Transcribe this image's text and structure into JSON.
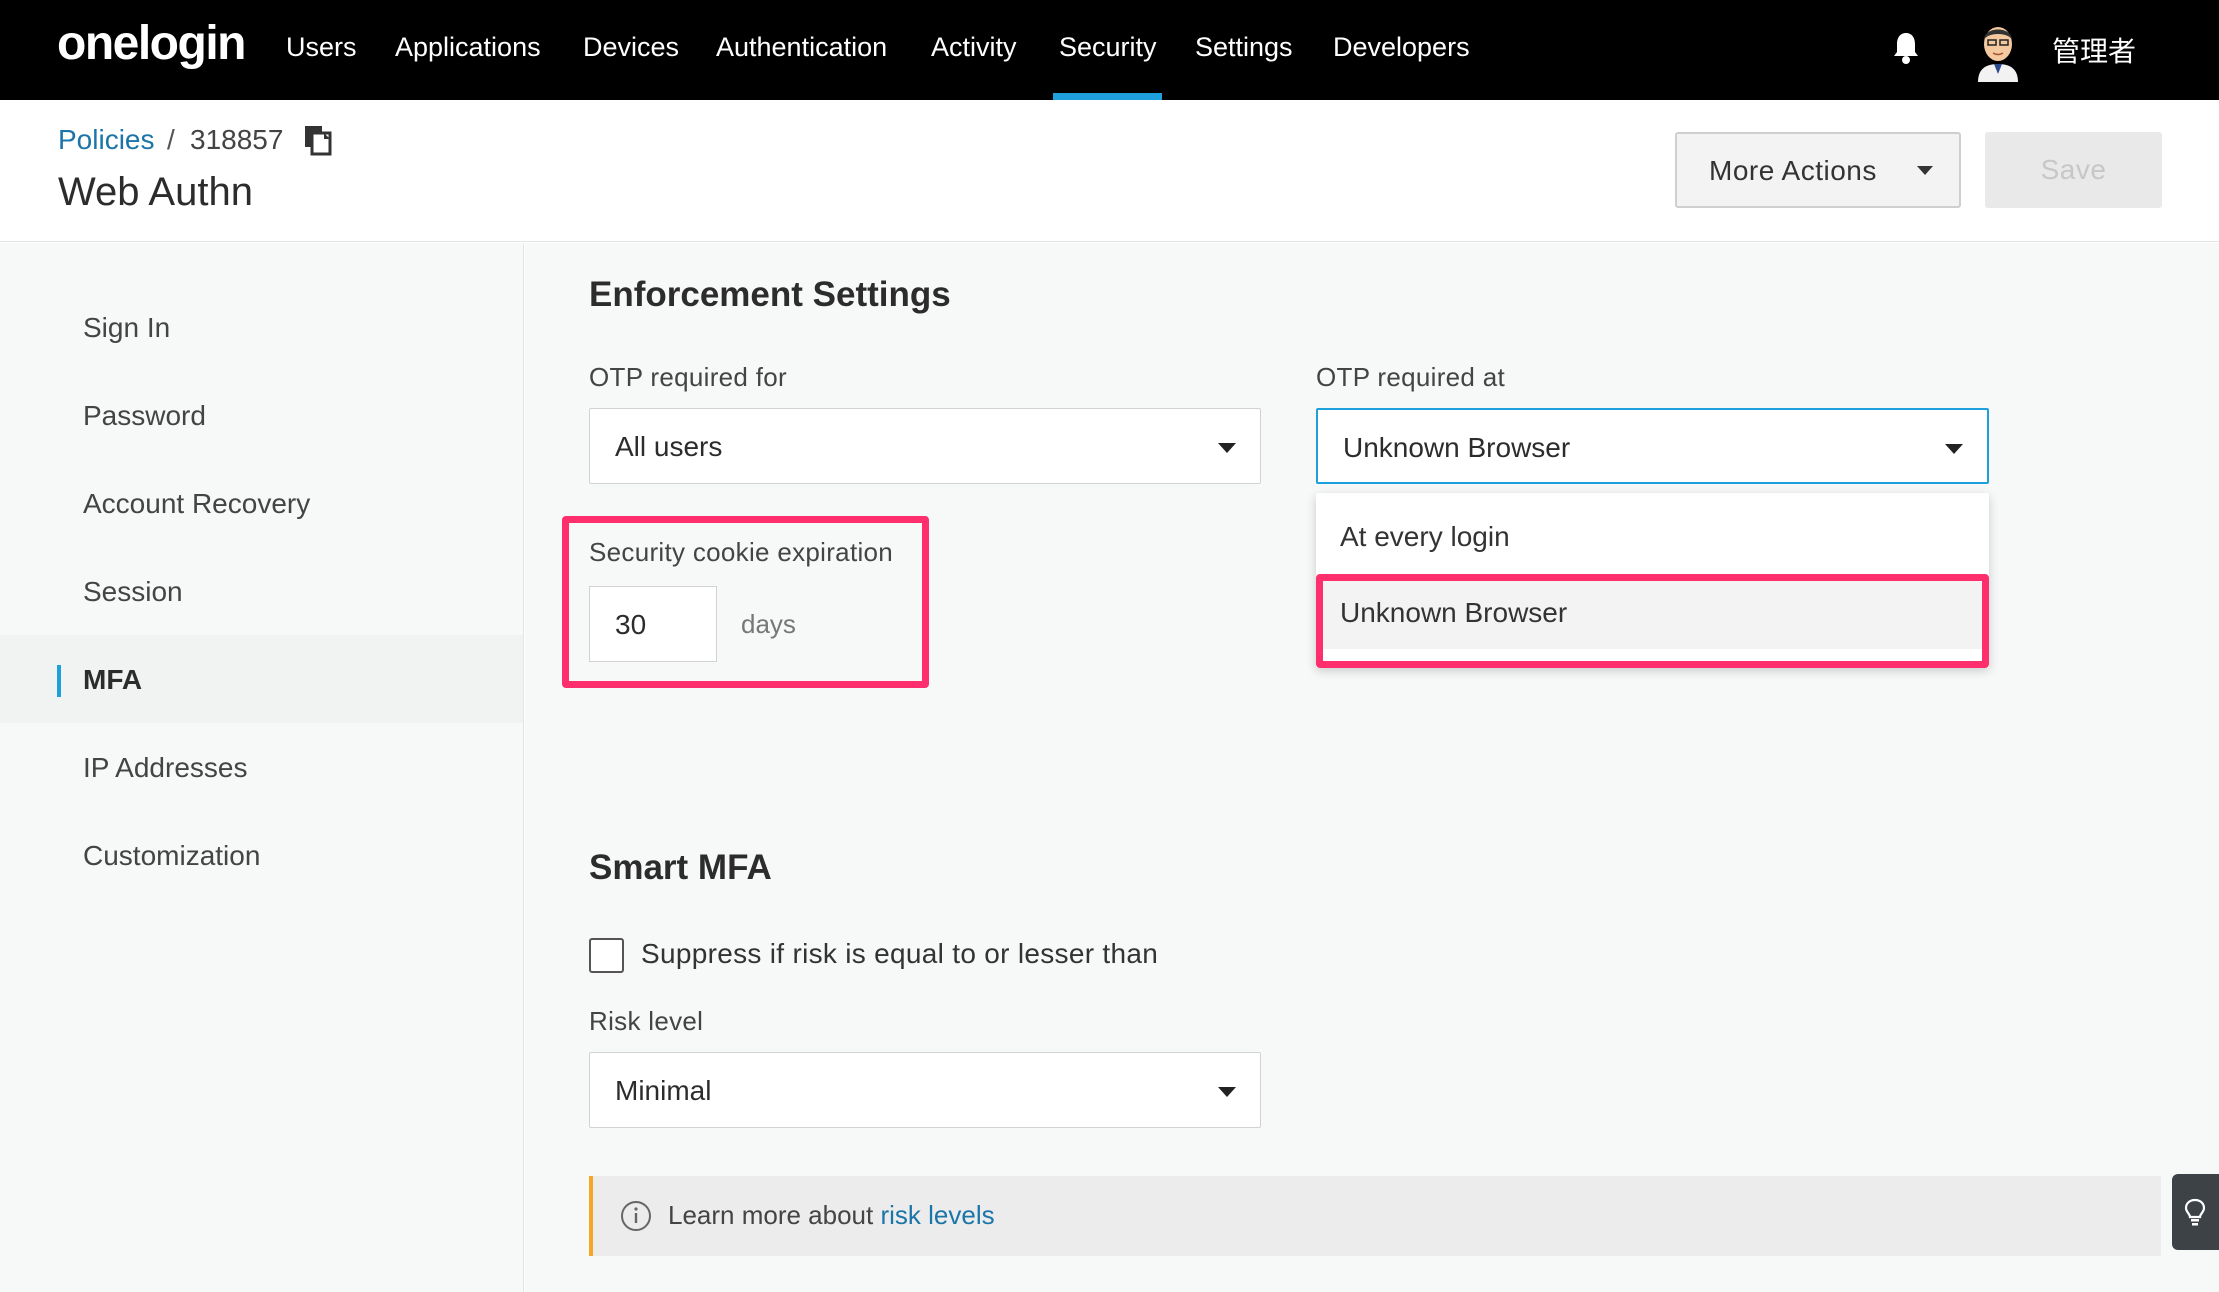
{
  "nav": {
    "logo": "onelogin",
    "items": [
      "Users",
      "Applications",
      "Devices",
      "Authentication",
      "Activity",
      "Security",
      "Settings",
      "Developers"
    ],
    "active": "Security",
    "username": "管理者"
  },
  "header": {
    "breadcrumb_link": "Policies",
    "breadcrumb_sep": "/",
    "policy_id": "318857",
    "title": "Web Authn",
    "more_actions_label": "More Actions",
    "save_label": "Save"
  },
  "sidebar": {
    "items": [
      {
        "label": "Sign In"
      },
      {
        "label": "Password"
      },
      {
        "label": "Account Recovery"
      },
      {
        "label": "Session"
      },
      {
        "label": "MFA",
        "active": true
      },
      {
        "label": "IP Addresses"
      },
      {
        "label": "Customization"
      }
    ]
  },
  "enforcement": {
    "heading": "Enforcement Settings",
    "otp_for_label": "OTP required for",
    "otp_for_value": "All users",
    "otp_at_label": "OTP required at",
    "otp_at_value": "Unknown Browser",
    "otp_at_options": [
      "At every login",
      "Unknown Browser"
    ],
    "otp_at_selected": "Unknown Browser",
    "cookie_label": "Security cookie expiration",
    "cookie_value": "30",
    "cookie_unit": "days"
  },
  "smart_mfa": {
    "heading": "Smart MFA",
    "suppress_label": "Suppress if risk is equal to or lesser than",
    "suppress_checked": false,
    "risk_label": "Risk level",
    "risk_value": "Minimal"
  },
  "info": {
    "text": "Learn more about",
    "link": "risk levels"
  },
  "colors": {
    "accent": "#1ea0dc",
    "highlight": "#ff2e6d",
    "link": "#1b75a8",
    "info_border": "#f5a623"
  }
}
